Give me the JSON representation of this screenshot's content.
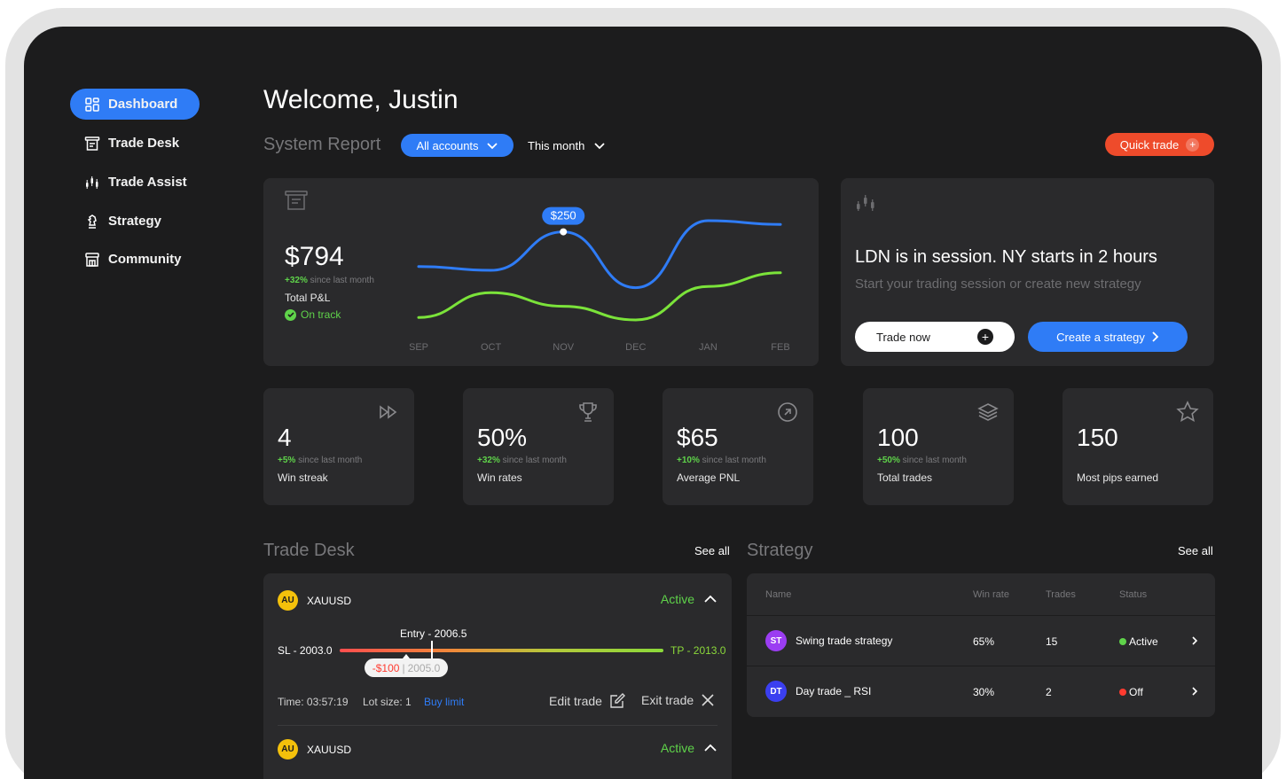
{
  "sidebar": {
    "items": [
      {
        "label": "Dashboard",
        "icon": "dashboard-icon",
        "active": true
      },
      {
        "label": "Trade Desk",
        "icon": "trade-desk-icon"
      },
      {
        "label": "Trade Assist",
        "icon": "trade-assist-icon"
      },
      {
        "label": "Strategy",
        "icon": "chess-knight-icon"
      },
      {
        "label": "Community",
        "icon": "community-icon"
      }
    ]
  },
  "header": {
    "welcome": "Welcome, Justin",
    "system_report": "System Report",
    "accounts_filter": "All accounts",
    "period_filter": "This month",
    "quick_trade": "Quick trade"
  },
  "pnl_card": {
    "value": "$794",
    "delta": "+32%",
    "delta_text": "since last month",
    "label": "Total P&L",
    "status": "On track",
    "tooltip": "$250"
  },
  "chart_data": {
    "type": "line",
    "categories": [
      "SEP",
      "OCT",
      "NOV",
      "DEC",
      "JAN",
      "FEB"
    ],
    "series": [
      {
        "values": [
          44,
          38,
          100,
          10,
          118,
          112
        ],
        "color": "#2f7cf6"
      },
      {
        "values": [
          -38,
          2,
          -20,
          -42,
          12,
          34
        ],
        "color": "#7be33a"
      }
    ],
    "highlight": {
      "series": 0,
      "category": "NOV",
      "label": "$250"
    }
  },
  "session_card": {
    "title": "LDN is in session. NY starts in 2 hours",
    "subtitle": "Start your trading session or create new strategy",
    "trade_now": "Trade now",
    "create_strategy": "Create a  strategy"
  },
  "stats": [
    {
      "value": "4",
      "delta": "+5%",
      "delta_text": "since last month",
      "label": "Win streak",
      "icon": "fast-forward-icon"
    },
    {
      "value": "50%",
      "delta": "+32%",
      "delta_text": "since last month",
      "label": "Win rates",
      "icon": "trophy-icon"
    },
    {
      "value": "$65",
      "delta": "+10%",
      "delta_text": "since last month",
      "label": "Average PNL",
      "icon": "arrow-up-right-circle-icon"
    },
    {
      "value": "100",
      "delta": "+50%",
      "delta_text": "since last month",
      "label": "Total trades",
      "icon": "layers-icon"
    },
    {
      "value": "150",
      "delta": "",
      "delta_text": "",
      "label": "Most pips earned",
      "icon": "star-icon"
    }
  ],
  "trade_desk": {
    "title": "Trade Desk",
    "see_all": "See all",
    "trades": [
      {
        "badge": "AU",
        "symbol": "XAUUSD",
        "status": "Active",
        "entry": "Entry - 2006.5",
        "sl": "SL - 2003.0",
        "tp": "TP - 2013.0",
        "current_pnl": "-$100",
        "current_price": "2005.0",
        "current_position": 0.2,
        "time": "Time: 03:57:19",
        "lot": "Lot size: 1",
        "order_type": "Buy limit",
        "edit": "Edit trade",
        "exit": "Exit trade"
      },
      {
        "badge": "AU",
        "symbol": "XAUUSD",
        "status": "Active"
      }
    ]
  },
  "strategy": {
    "title": "Strategy",
    "see_all": "See all",
    "columns": [
      "Name",
      "Win rate",
      "Trades",
      "Status"
    ],
    "rows": [
      {
        "badge": "ST",
        "badge_color": "#9b3df2",
        "name": "Swing trade strategy",
        "win_rate": "65%",
        "trades": "15",
        "status": "Active",
        "status_color": "#5fd34a"
      },
      {
        "badge": "DT",
        "badge_color": "#3b3ff0",
        "name": "Day trade _ RSI",
        "win_rate": "30%",
        "trades": "2",
        "status": "Off",
        "status_color": "#ff3b30"
      }
    ]
  }
}
